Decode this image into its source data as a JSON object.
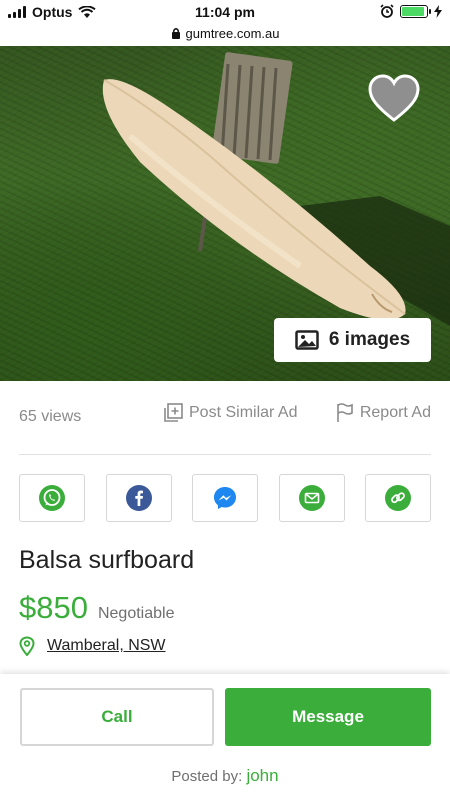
{
  "status_bar": {
    "carrier": "Optus",
    "time": "11:04 pm",
    "battery_level": 0.9,
    "icons": [
      "signal-icon",
      "wifi-icon",
      "alarm-icon",
      "battery-icon",
      "charging-icon"
    ]
  },
  "browser": {
    "url": "gumtree.com.au",
    "icons": [
      "lock-icon"
    ]
  },
  "gallery": {
    "images_label": "6 images",
    "icons": [
      "heart-icon",
      "image-icon"
    ]
  },
  "meta": {
    "views": "65 views",
    "post_similar_label": "Post Similar Ad",
    "report_label": "Report Ad"
  },
  "share": {
    "buttons": [
      "whatsapp-icon",
      "facebook-icon",
      "messenger-icon",
      "email-icon",
      "link-icon"
    ]
  },
  "listing": {
    "title": "Balsa surfboard",
    "price": "$850",
    "price_note": "Negotiable",
    "location": "Wamberal, NSW"
  },
  "actions": {
    "call_label": "Call",
    "message_label": "Message",
    "posted_by_label": "Posted by:",
    "posted_by_user": "john"
  },
  "colors": {
    "brand_green": "#3aad3a",
    "muted_text": "#8a8a8a",
    "facebook_blue": "#3b5998",
    "messenger_blue": "#1e88f0"
  }
}
